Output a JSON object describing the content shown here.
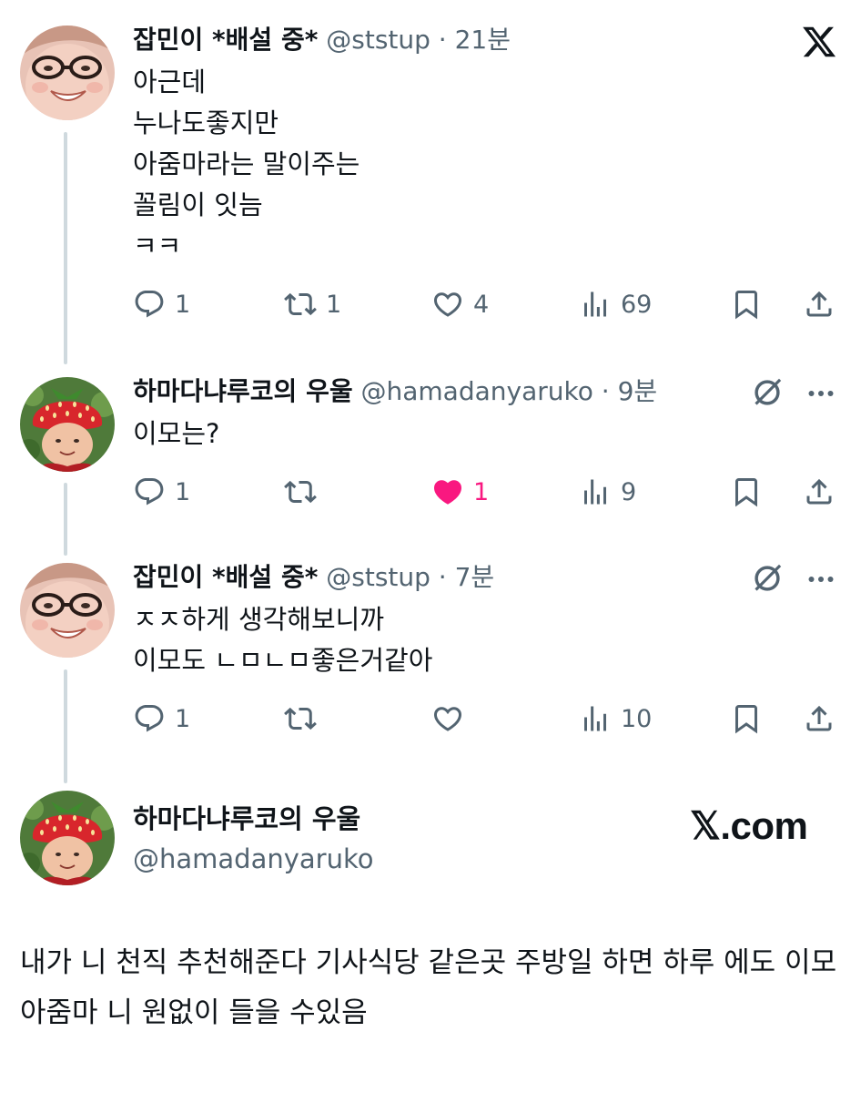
{
  "tweets": [
    {
      "name": "잡민이 *배설 중*",
      "handle": "@ststup",
      "sep": " · ",
      "time": "21분",
      "lines": [
        "아근데",
        "누나도좋지만",
        "아줌마라는 말이주는",
        "꼴림이 잇늠",
        "ㅋㅋ"
      ],
      "replies": "1",
      "retweets": "1",
      "likes": "4",
      "views": "69"
    },
    {
      "name": "하마다냐루코의 우울",
      "handle": "@hamadanyaruko",
      "sep": " · ",
      "time": "9분",
      "lines": [
        "이모는?"
      ],
      "replies": "1",
      "retweets": "",
      "likes": "1",
      "views": "9"
    },
    {
      "name": "잡민이 *배설 중*",
      "handle": "@ststup",
      "sep": " · ",
      "time": "7분",
      "lines": [
        "ㅈㅈ하게 생각해보니까",
        "이모도 ㄴㅁㄴㅁ좋은거같아"
      ],
      "replies": "1",
      "retweets": "",
      "likes": "",
      "views": "10"
    }
  ],
  "card": {
    "name": "하마다냐루코의 우울",
    "handle": "@hamadanyaruko",
    "brand": "𝕏.com"
  },
  "quote_text": "내가 니 천직 추천해준다 기사식당 같은곳 주방일 하면 하루 에도 이모 아줌마 니 원없이 들을 수있음",
  "icons": [
    "x-logo-icon",
    "reply-icon",
    "retweet-icon",
    "heart-icon",
    "views-icon",
    "bookmark-icon",
    "share-icon",
    "grok-icon",
    "more-icon"
  ],
  "colors": {
    "text": "#0f1419",
    "secondary": "#536471",
    "like": "#f91880",
    "thread": "#cfd9de"
  }
}
